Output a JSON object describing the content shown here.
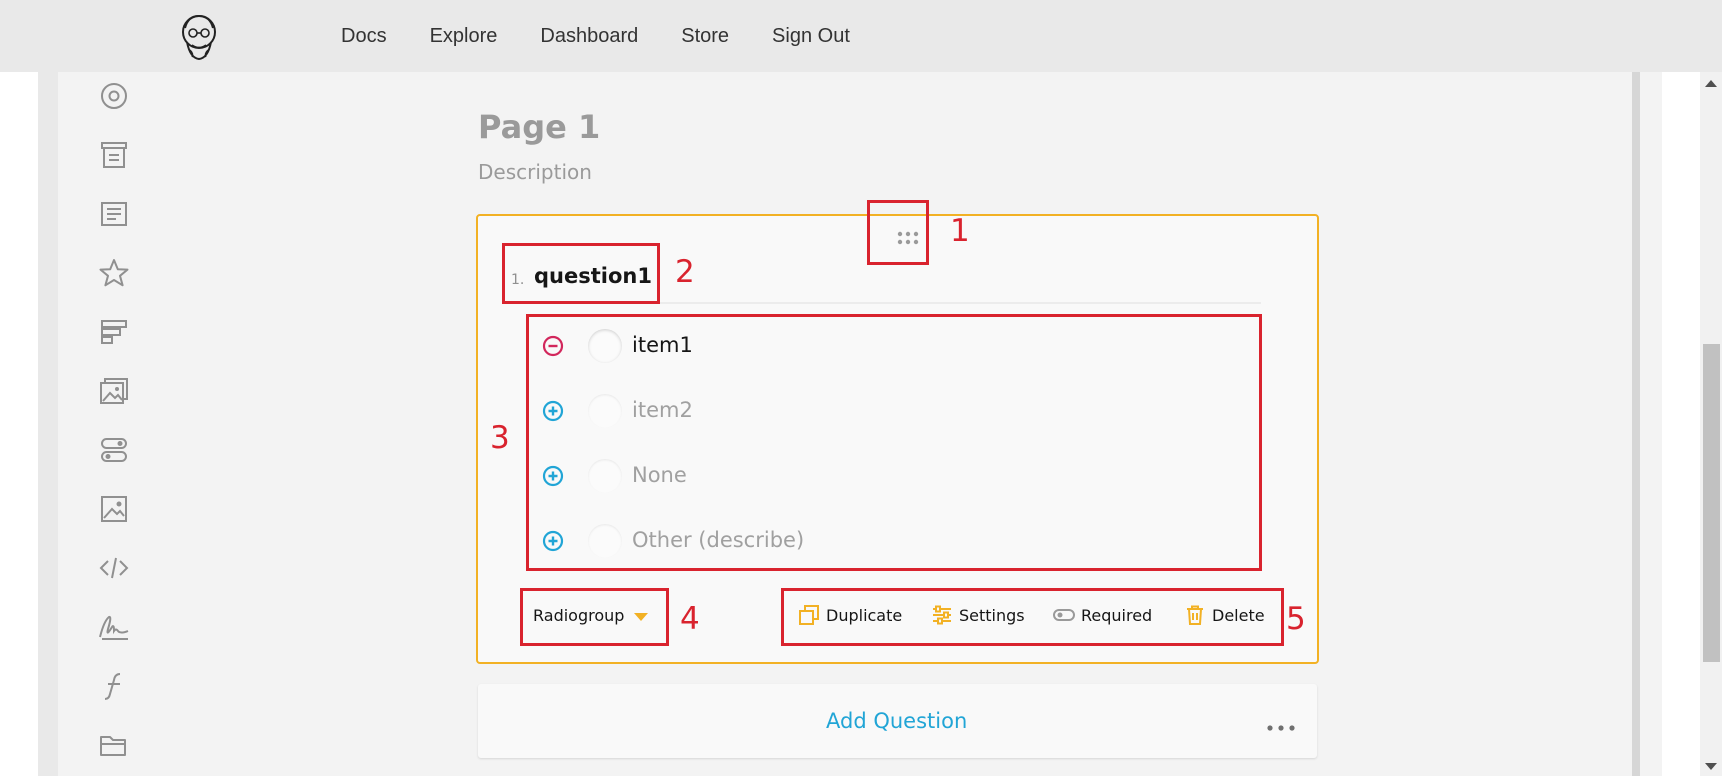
{
  "nav": {
    "items": [
      "Docs",
      "Explore",
      "Dashboard",
      "Store",
      "Sign Out"
    ]
  },
  "toolbox": {
    "icons": [
      "radiogroup-icon",
      "rating-list-icon",
      "comment-icon",
      "star-icon",
      "ranking-icon",
      "image-picker-icon",
      "boolean-icon",
      "image-icon",
      "html-icon",
      "signature-icon",
      "expression-icon",
      "file-icon"
    ]
  },
  "page": {
    "title": "Page 1",
    "description": "Description"
  },
  "question": {
    "number": "1.",
    "title": "question1",
    "choices": [
      {
        "label": "item1",
        "action": "remove",
        "active": true
      },
      {
        "label": "item2",
        "action": "add",
        "active": false
      },
      {
        "label": "None",
        "action": "add",
        "active": false
      },
      {
        "label": "Other (describe)",
        "action": "add",
        "active": false
      }
    ],
    "type_label": "Radiogroup",
    "actions": {
      "duplicate": "Duplicate",
      "settings": "Settings",
      "required": "Required",
      "delete": "Delete"
    }
  },
  "add_question": {
    "label": "Add Question"
  },
  "annotations": [
    "1",
    "2",
    "3",
    "4",
    "5"
  ],
  "colors": {
    "accent": "#f2b124",
    "link": "#21a5d6",
    "remove": "#d2275c",
    "annotation": "#d9232e"
  }
}
